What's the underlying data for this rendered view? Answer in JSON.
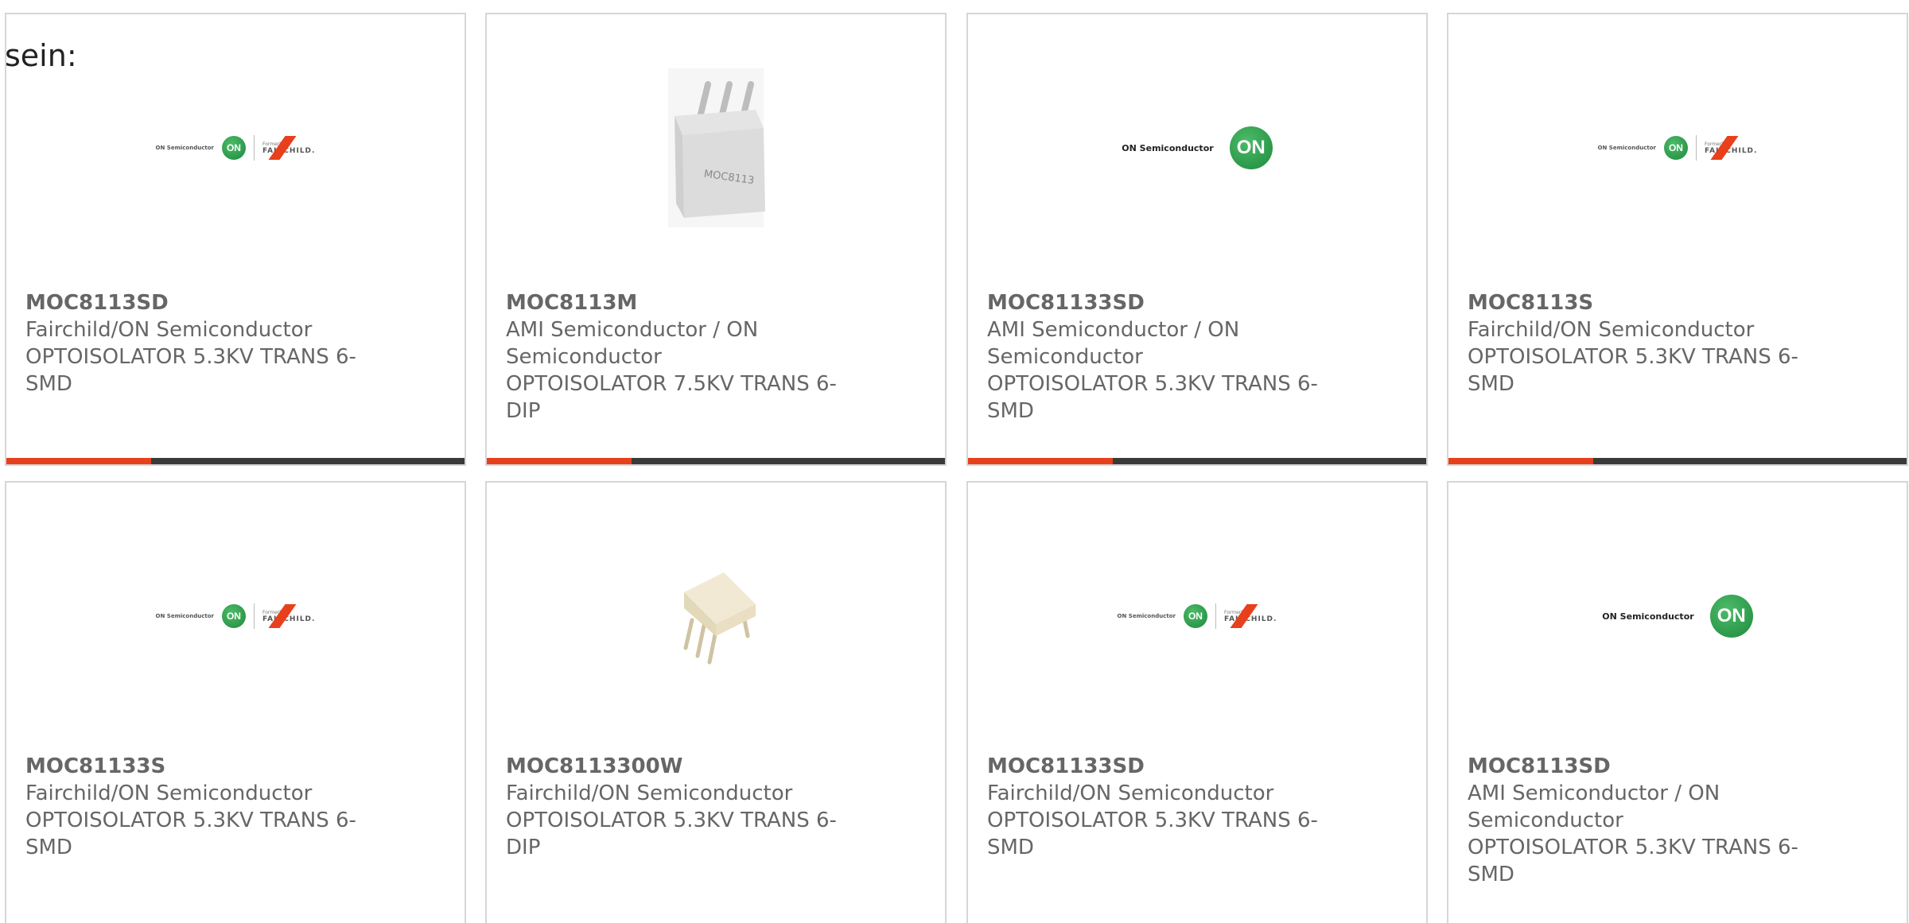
{
  "intro": "sein:",
  "logo_text": {
    "on_semi": "ON Semiconductor",
    "on_mark": "ON",
    "formerly": "Formerly",
    "fairchild": "FAIRCHILD."
  },
  "colors": {
    "accent": "#e8401c",
    "bar_dark": "#3a3a3a",
    "on_green": "#1e8a3c"
  },
  "products": [
    {
      "part": "MOC8113SD",
      "manufacturer": "Fairchild/ON Semiconductor",
      "description": "OPTOISOLATOR 5.3KV TRANS 6-SMD",
      "image": "on-fairchild-logo"
    },
    {
      "part": "MOC8113M",
      "manufacturer": "AMI Semiconductor / ON Semiconductor",
      "description": "OPTOISOLATOR 7.5KV TRANS 6-DIP",
      "image": "chip-photo"
    },
    {
      "part": "MOC81133SD",
      "manufacturer": "AMI Semiconductor / ON Semiconductor",
      "description": "OPTOISOLATOR 5.3KV TRANS 6-SMD",
      "image": "on-semi-logo"
    },
    {
      "part": "MOC8113S",
      "manufacturer": "Fairchild/ON Semiconductor",
      "description": "OPTOISOLATOR 5.3KV TRANS 6-SMD",
      "image": "on-fairchild-logo"
    },
    {
      "part": "MOC81133S",
      "manufacturer": "Fairchild/ON Semiconductor",
      "description": "OPTOISOLATOR 5.3KV TRANS 6-SMD",
      "image": "on-fairchild-logo"
    },
    {
      "part": "MOC8113300W",
      "manufacturer": "Fairchild/ON Semiconductor",
      "description": "OPTOISOLATOR 5.3KV TRANS 6-DIP",
      "image": "chip-photo"
    },
    {
      "part": "MOC81133SD",
      "manufacturer": "Fairchild/ON Semiconductor",
      "description": "OPTOISOLATOR 5.3KV TRANS 6-SMD",
      "image": "on-fairchild-logo"
    },
    {
      "part": "MOC8113SD",
      "manufacturer": "AMI Semiconductor / ON Semiconductor",
      "description": "OPTOISOLATOR 5.3KV TRANS 6-SMD",
      "image": "on-semi-logo"
    }
  ]
}
